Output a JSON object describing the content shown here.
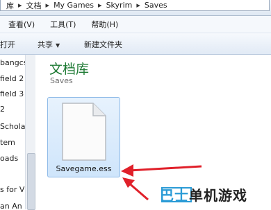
{
  "address_bar": {
    "crumbs": [
      "库",
      "文档",
      "My Games",
      "Skyrim",
      "Saves"
    ]
  },
  "menu": {
    "items": [
      "查看(V)",
      "工具(T)",
      "帮助(H)"
    ]
  },
  "toolbar": {
    "open_label": "打开",
    "share_label": "共享",
    "new_folder_label": "新建文件夹"
  },
  "nav_pane": {
    "items": [
      "bangcs",
      "field 2",
      "field 3",
      "2",
      "Schola",
      "tem",
      "oads",
      "",
      "s for V",
      "an An"
    ]
  },
  "library": {
    "title": "文档库",
    "subtitle": "Saves"
  },
  "file": {
    "name": "Savegame.ess",
    "icon": "document-icon"
  },
  "watermark": {
    "text": "巴士单机游戏"
  },
  "colors": {
    "library_title": "#1e7a34",
    "selection": "#cfe5fb",
    "annotation_arrow": "#e0202a",
    "watermark_blue": "#2a9bd6",
    "watermark_dark": "#222222"
  }
}
